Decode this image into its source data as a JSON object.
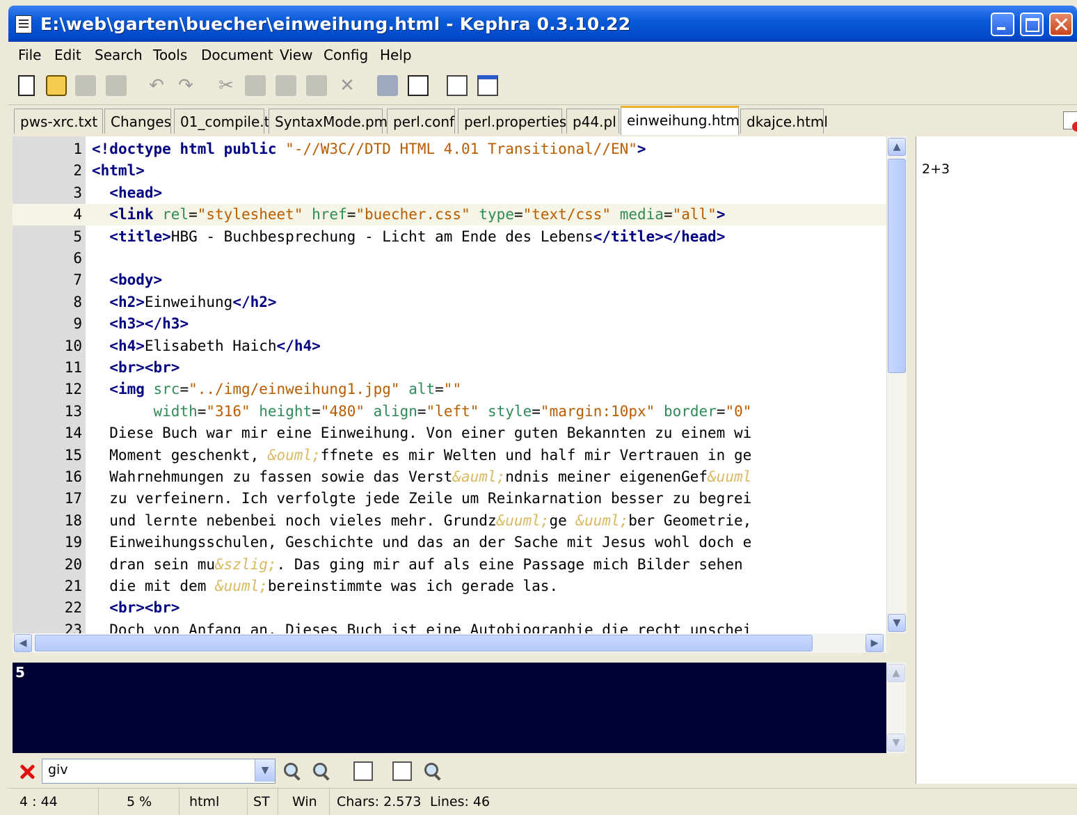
{
  "window": {
    "title": "E:\\web\\garten\\buecher\\einweihung.html - Kephra 0.3.10.22"
  },
  "menu": [
    "File",
    "Edit",
    "Search",
    "Tools",
    "Document",
    "View",
    "Config",
    "Help"
  ],
  "toolbar_icons": [
    "new-document-icon",
    "open-icon",
    "save-icon",
    "save-all-icon",
    "undo-icon",
    "redo-icon",
    "cut-icon",
    "copy-icon",
    "paste-icon",
    "replace-icon",
    "delete-icon",
    "comment-icon",
    "close-all-icon",
    "edit-mode-icon",
    "window-icon"
  ],
  "tabs": [
    "pws-xrc.txt",
    "Changes",
    "01_compile.t",
    "SyntaxMode.pm",
    "perl.conf",
    "perl.properties",
    "p44.pl",
    "einweihung.html",
    "dkajce.html"
  ],
  "active_tab": "einweihung.html",
  "editor": {
    "current_line": 4,
    "lines": [
      {
        "n": "1",
        "segs": [
          [
            "t",
            "<!"
          ],
          [
            "t",
            "doctype html public "
          ],
          [
            "v",
            "\"-//W3C//DTD HTML 4.01 Transitional//EN\""
          ],
          [
            "t",
            ">"
          ]
        ]
      },
      {
        "n": "2",
        "segs": [
          [
            "t",
            "<html>"
          ]
        ]
      },
      {
        "n": "3",
        "segs": [
          [
            "",
            "  "
          ],
          [
            "t",
            "<head>"
          ]
        ]
      },
      {
        "n": "4",
        "segs": [
          [
            "",
            "  "
          ],
          [
            "t",
            "<link "
          ],
          [
            "a",
            "rel"
          ],
          [
            "",
            "="
          ],
          [
            "v",
            "\"stylesheet\""
          ],
          [
            "",
            " "
          ],
          [
            "a",
            "href"
          ],
          [
            "",
            "="
          ],
          [
            "v",
            "\"buecher.css\""
          ],
          [
            "",
            " "
          ],
          [
            "a",
            "type"
          ],
          [
            "",
            "="
          ],
          [
            "v",
            "\"text/css\""
          ],
          [
            "",
            " "
          ],
          [
            "a",
            "media"
          ],
          [
            "",
            "="
          ],
          [
            "v",
            "\"all\""
          ],
          [
            "t",
            ">"
          ]
        ]
      },
      {
        "n": "5",
        "segs": [
          [
            "",
            "  "
          ],
          [
            "t",
            "<title>"
          ],
          [
            "",
            "HBG - Buchbesprechung - Licht am Ende des Lebens"
          ],
          [
            "t",
            "</title></head>"
          ]
        ]
      },
      {
        "n": "6",
        "segs": []
      },
      {
        "n": "7",
        "segs": [
          [
            "",
            "  "
          ],
          [
            "t",
            "<body>"
          ]
        ]
      },
      {
        "n": "8",
        "segs": [
          [
            "",
            "  "
          ],
          [
            "t",
            "<h2>"
          ],
          [
            "",
            "Einweihung"
          ],
          [
            "t",
            "</h2>"
          ]
        ]
      },
      {
        "n": "9",
        "segs": [
          [
            "",
            "  "
          ],
          [
            "t",
            "<h3></h3>"
          ]
        ]
      },
      {
        "n": "10",
        "segs": [
          [
            "",
            "  "
          ],
          [
            "t",
            "<h4>"
          ],
          [
            "",
            "Elisabeth Haich"
          ],
          [
            "t",
            "</h4>"
          ]
        ]
      },
      {
        "n": "11",
        "segs": [
          [
            "",
            "  "
          ],
          [
            "t",
            "<br><br>"
          ]
        ]
      },
      {
        "n": "12",
        "segs": [
          [
            "",
            "  "
          ],
          [
            "t",
            "<img "
          ],
          [
            "a",
            "src"
          ],
          [
            "",
            "="
          ],
          [
            "v",
            "\"../img/einweihung1.jpg\""
          ],
          [
            "",
            " "
          ],
          [
            "a",
            "alt"
          ],
          [
            "",
            "="
          ],
          [
            "v",
            "\"\""
          ]
        ]
      },
      {
        "n": "13",
        "segs": [
          [
            "",
            "       "
          ],
          [
            "a",
            "width"
          ],
          [
            "",
            "="
          ],
          [
            "v",
            "\"316\""
          ],
          [
            "",
            " "
          ],
          [
            "a",
            "height"
          ],
          [
            "",
            "="
          ],
          [
            "v",
            "\"480\""
          ],
          [
            "",
            " "
          ],
          [
            "a",
            "align"
          ],
          [
            "",
            "="
          ],
          [
            "v",
            "\"left\""
          ],
          [
            "",
            " "
          ],
          [
            "a",
            "style"
          ],
          [
            "",
            "="
          ],
          [
            "v",
            "\"margin:10px\""
          ],
          [
            "",
            " "
          ],
          [
            "a",
            "border"
          ],
          [
            "",
            "="
          ],
          [
            "v",
            "\"0\""
          ]
        ]
      },
      {
        "n": "14",
        "segs": [
          [
            "",
            "  Diese Buch war mir eine Einweihung. Von einer guten Bekannten zu einem wi"
          ]
        ]
      },
      {
        "n": "15",
        "segs": [
          [
            "",
            "  Moment geschenkt, "
          ],
          [
            "e",
            "&ouml;"
          ],
          [
            "",
            "ffnete es mir Welten und half mir Vertrauen in ge"
          ]
        ]
      },
      {
        "n": "16",
        "segs": [
          [
            "",
            "  Wahrnehmungen zu fassen sowie das Verst"
          ],
          [
            "e",
            "&auml;"
          ],
          [
            "",
            "ndnis meiner eigenenGef"
          ],
          [
            "e",
            "&uuml"
          ]
        ]
      },
      {
        "n": "17",
        "segs": [
          [
            "",
            "  zu verfeinern. Ich verfolgte jede Zeile um Reinkarnation besser zu begrei"
          ]
        ]
      },
      {
        "n": "18",
        "segs": [
          [
            "",
            "  und lernte nebenbei noch vieles mehr. Grundz"
          ],
          [
            "e",
            "&uuml;"
          ],
          [
            "",
            "ge "
          ],
          [
            "e",
            "&uuml;"
          ],
          [
            "",
            "ber Geometrie,"
          ]
        ]
      },
      {
        "n": "19",
        "segs": [
          [
            "",
            "  Einweihungsschulen, Geschichte und das an der Sache mit Jesus wohl doch e"
          ]
        ]
      },
      {
        "n": "20",
        "segs": [
          [
            "",
            "  dran sein mu"
          ],
          [
            "e",
            "&szlig;"
          ],
          [
            "",
            ". Das ging mir auf als eine Passage mich Bilder sehen"
          ]
        ]
      },
      {
        "n": "21",
        "segs": [
          [
            "",
            "  die mit dem "
          ],
          [
            "e",
            "&uuml;"
          ],
          [
            "",
            "bereinstimmte was ich gerade las."
          ]
        ]
      },
      {
        "n": "22",
        "segs": [
          [
            "",
            "  "
          ],
          [
            "t",
            "<br><br>"
          ]
        ]
      },
      {
        "n": "23",
        "segs": [
          [
            "",
            "  Doch von Anfang an. Dieses Buch ist eine Autobiographie die recht unschei"
          ]
        ]
      }
    ]
  },
  "side_panel": {
    "expression": "2+3"
  },
  "output": {
    "value": "5"
  },
  "search": {
    "value": "giv"
  },
  "status": {
    "position": "4 : 44",
    "percent": "5 %",
    "syntax": "html",
    "indent": "ST",
    "eol": "Win",
    "chars": "Chars: 2.573",
    "lines": "Lines: 46"
  }
}
